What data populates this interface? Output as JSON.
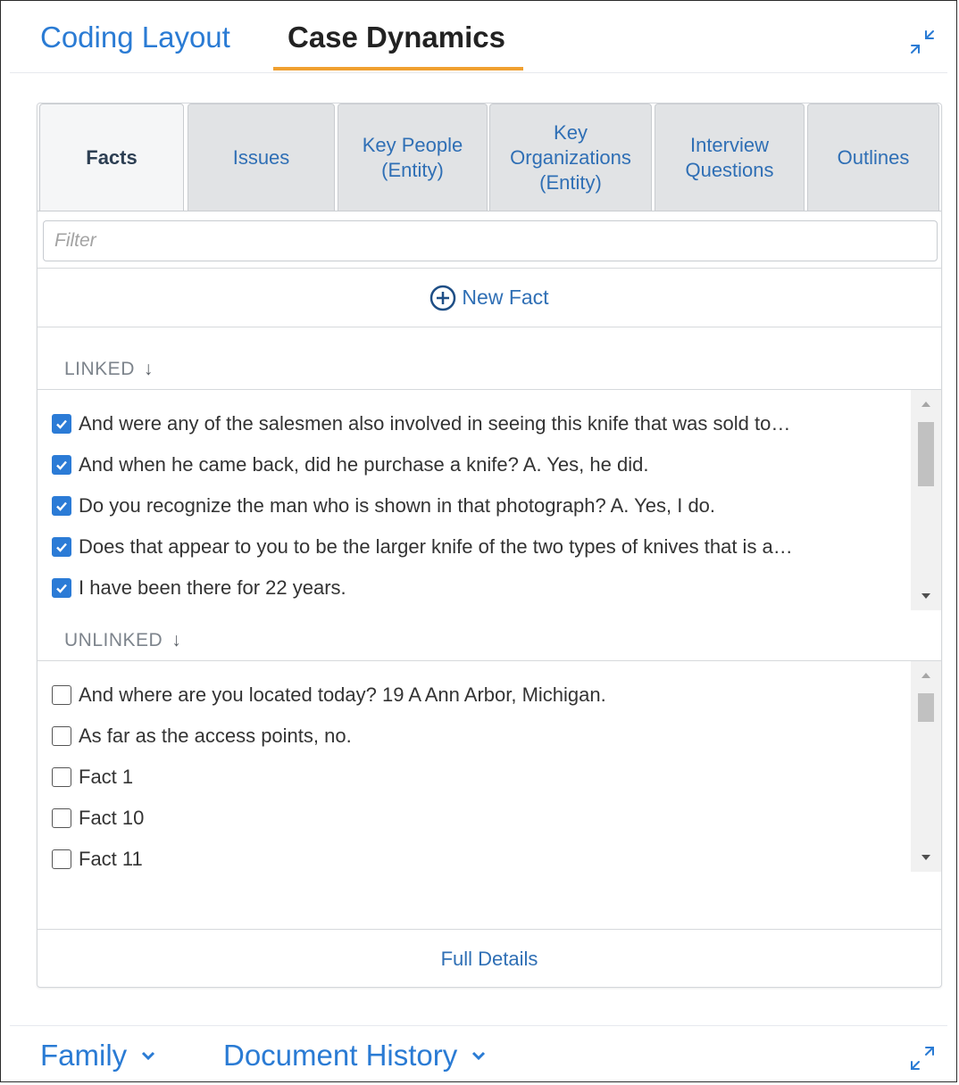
{
  "top_tabs": [
    {
      "label": "Coding Layout",
      "active": false
    },
    {
      "label": "Case Dynamics",
      "active": true
    }
  ],
  "sub_tabs": [
    {
      "label": "Facts",
      "active": true
    },
    {
      "label": "Issues",
      "active": false
    },
    {
      "label": "Key People\n(Entity)",
      "active": false
    },
    {
      "label": "Key\nOrganizations\n(Entity)",
      "active": false
    },
    {
      "label": "Interview\nQuestions",
      "active": false
    },
    {
      "label": "Outlines",
      "active": false
    }
  ],
  "filter": {
    "placeholder": "Filter",
    "value": ""
  },
  "new_fact": {
    "label": "New Fact",
    "icon": "plus-circle-icon"
  },
  "linked": {
    "header": "LINKED",
    "sort_icon": "arrow-down-icon",
    "items": [
      {
        "text": "And were any of the salesmen also involved in seeing this knife that was sold to…",
        "checked": true
      },
      {
        "text": "And when he came back, did he purchase a knife?   A. Yes, he did.",
        "checked": true
      },
      {
        "text": "Do you recognize the man who is shown in that photograph?   A. Yes, I do.",
        "checked": true
      },
      {
        "text": "Does that appear to you to be the larger knife of the two types of knives that is a…",
        "checked": true
      },
      {
        "text": "I have been there for 22 years.",
        "checked": true
      }
    ]
  },
  "unlinked": {
    "header": "UNLINKED",
    "sort_icon": "arrow-down-icon",
    "items": [
      {
        "text": "And where are you located today? 19   A Ann Arbor, Michigan.",
        "checked": false
      },
      {
        "text": "As far as the access points, no.",
        "checked": false
      },
      {
        "text": "Fact 1",
        "checked": false
      },
      {
        "text": "Fact 10",
        "checked": false
      },
      {
        "text": "Fact 11",
        "checked": false
      }
    ]
  },
  "full_details": "Full Details",
  "bottom_tabs": [
    {
      "label": "Family",
      "icon": "chevron-down-icon"
    },
    {
      "label": "Document History",
      "icon": "chevron-down-icon"
    }
  ],
  "colors": {
    "accent": "#2a7bd4",
    "active_underline": "#f0a030",
    "checkbox": "#2b7bd6"
  }
}
